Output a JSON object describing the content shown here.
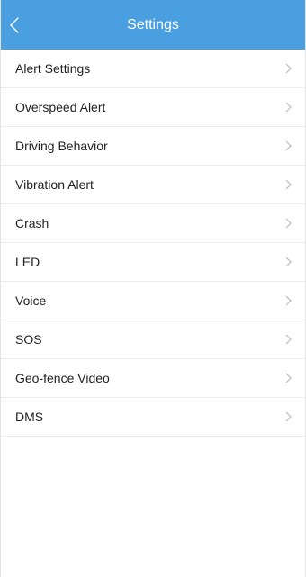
{
  "header": {
    "title": "Settings",
    "background": "#4a9fe0",
    "back_icon": "chevron-left-icon"
  },
  "menu": {
    "items": [
      {
        "label": "Alert Settings"
      },
      {
        "label": "Overspeed Alert"
      },
      {
        "label": "Driving Behavior"
      },
      {
        "label": "Vibration Alert"
      },
      {
        "label": "Crash"
      },
      {
        "label": "LED"
      },
      {
        "label": "Voice"
      },
      {
        "label": "SOS"
      },
      {
        "label": "Geo-fence Video"
      },
      {
        "label": "DMS"
      }
    ],
    "row_icon": "chevron-right-icon"
  }
}
